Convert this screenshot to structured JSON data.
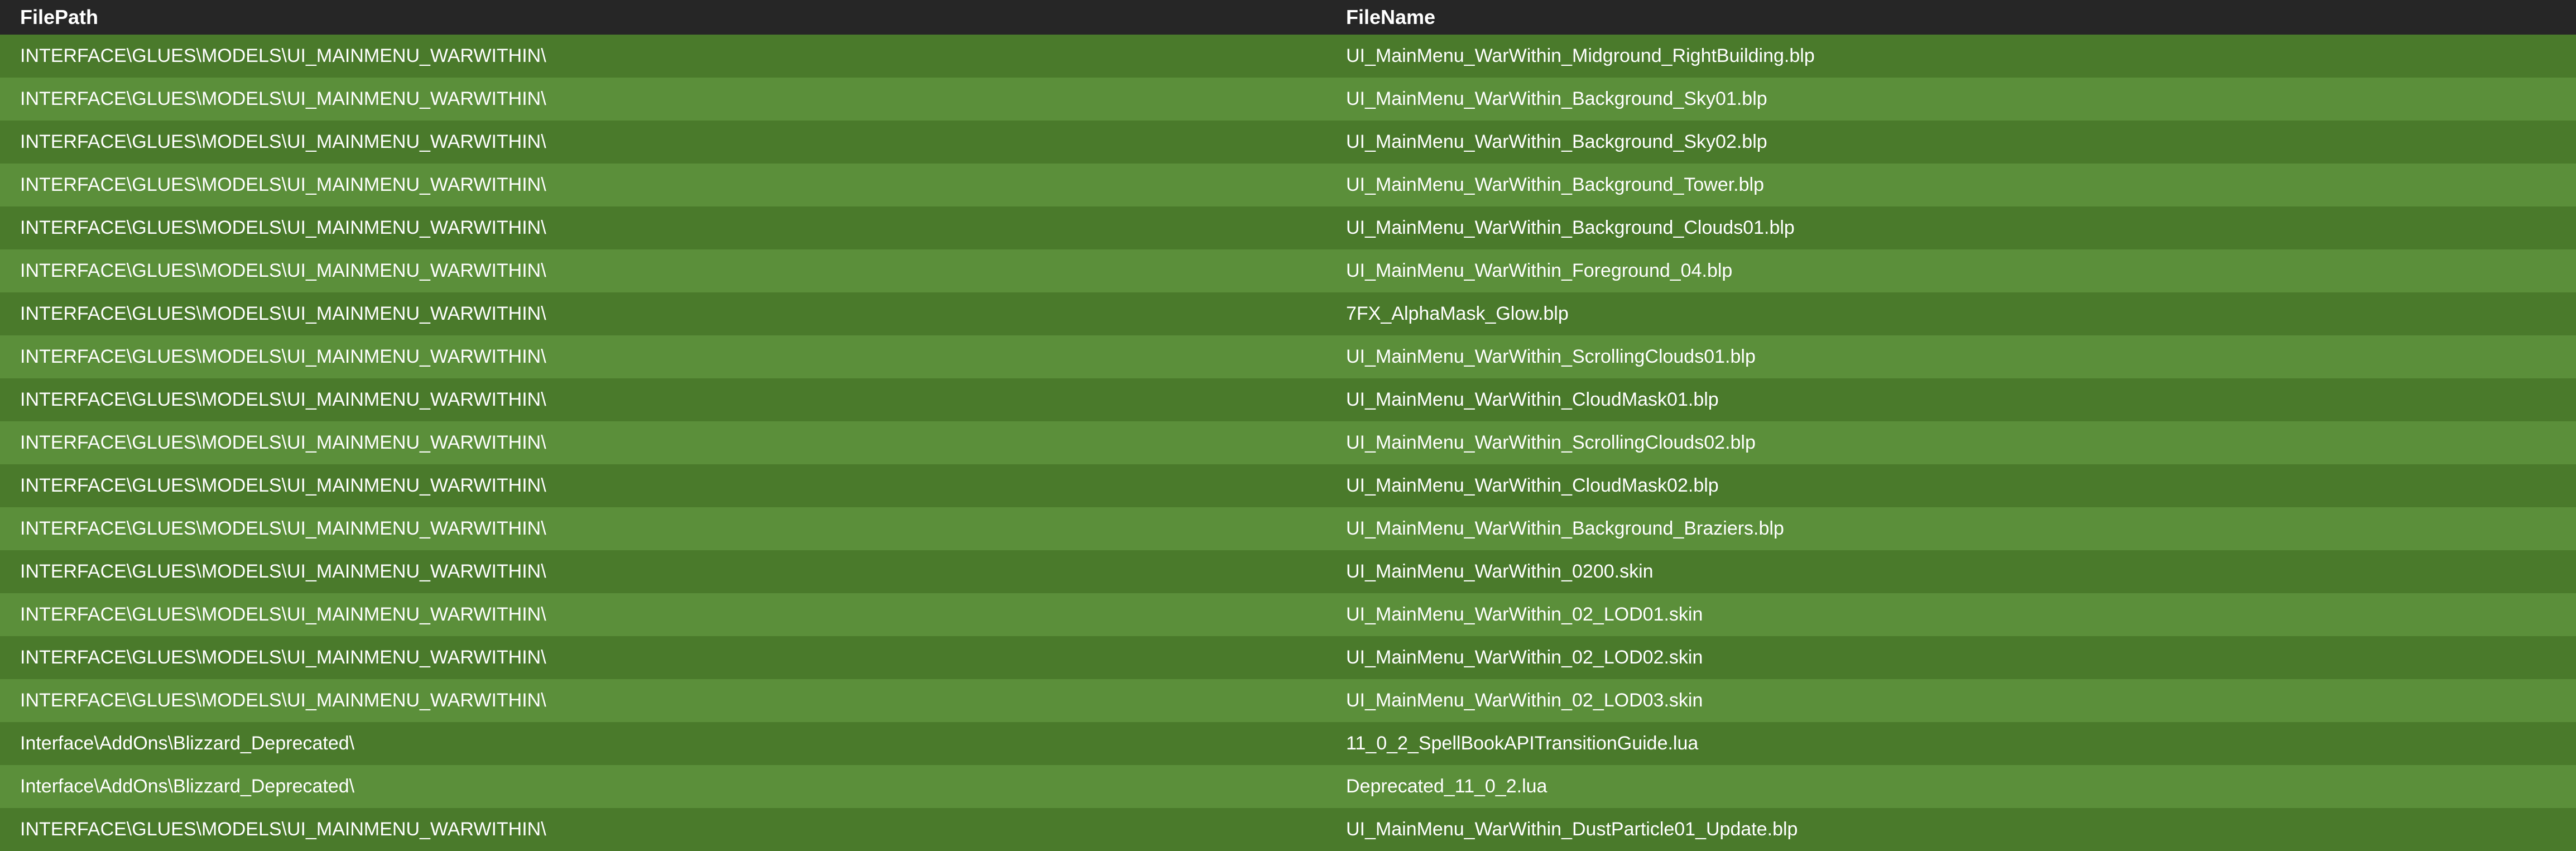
{
  "columns": {
    "filepath": "FilePath",
    "filename": "FileName"
  },
  "rows": [
    {
      "path": "INTERFACE\\GLUES\\MODELS\\UI_MAINMENU_WARWITHIN\\",
      "name": "UI_MainMenu_WarWithin_Midground_RightBuilding.blp"
    },
    {
      "path": "INTERFACE\\GLUES\\MODELS\\UI_MAINMENU_WARWITHIN\\",
      "name": "UI_MainMenu_WarWithin_Background_Sky01.blp"
    },
    {
      "path": "INTERFACE\\GLUES\\MODELS\\UI_MAINMENU_WARWITHIN\\",
      "name": "UI_MainMenu_WarWithin_Background_Sky02.blp"
    },
    {
      "path": "INTERFACE\\GLUES\\MODELS\\UI_MAINMENU_WARWITHIN\\",
      "name": "UI_MainMenu_WarWithin_Background_Tower.blp"
    },
    {
      "path": "INTERFACE\\GLUES\\MODELS\\UI_MAINMENU_WARWITHIN\\",
      "name": "UI_MainMenu_WarWithin_Background_Clouds01.blp"
    },
    {
      "path": "INTERFACE\\GLUES\\MODELS\\UI_MAINMENU_WARWITHIN\\",
      "name": "UI_MainMenu_WarWithin_Foreground_04.blp"
    },
    {
      "path": "INTERFACE\\GLUES\\MODELS\\UI_MAINMENU_WARWITHIN\\",
      "name": "7FX_AlphaMask_Glow.blp"
    },
    {
      "path": "INTERFACE\\GLUES\\MODELS\\UI_MAINMENU_WARWITHIN\\",
      "name": "UI_MainMenu_WarWithin_ScrollingClouds01.blp"
    },
    {
      "path": "INTERFACE\\GLUES\\MODELS\\UI_MAINMENU_WARWITHIN\\",
      "name": "UI_MainMenu_WarWithin_CloudMask01.blp"
    },
    {
      "path": "INTERFACE\\GLUES\\MODELS\\UI_MAINMENU_WARWITHIN\\",
      "name": "UI_MainMenu_WarWithin_ScrollingClouds02.blp"
    },
    {
      "path": "INTERFACE\\GLUES\\MODELS\\UI_MAINMENU_WARWITHIN\\",
      "name": "UI_MainMenu_WarWithin_CloudMask02.blp"
    },
    {
      "path": "INTERFACE\\GLUES\\MODELS\\UI_MAINMENU_WARWITHIN\\",
      "name": "UI_MainMenu_WarWithin_Background_Braziers.blp"
    },
    {
      "path": "INTERFACE\\GLUES\\MODELS\\UI_MAINMENU_WARWITHIN\\",
      "name": "UI_MainMenu_WarWithin_0200.skin"
    },
    {
      "path": "INTERFACE\\GLUES\\MODELS\\UI_MAINMENU_WARWITHIN\\",
      "name": "UI_MainMenu_WarWithin_02_LOD01.skin"
    },
    {
      "path": "INTERFACE\\GLUES\\MODELS\\UI_MAINMENU_WARWITHIN\\",
      "name": "UI_MainMenu_WarWithin_02_LOD02.skin"
    },
    {
      "path": "INTERFACE\\GLUES\\MODELS\\UI_MAINMENU_WARWITHIN\\",
      "name": "UI_MainMenu_WarWithin_02_LOD03.skin"
    },
    {
      "path": "Interface\\AddOns\\Blizzard_Deprecated\\",
      "name": "11_0_2_SpellBookAPITransitionGuide.lua"
    },
    {
      "path": "Interface\\AddOns\\Blizzard_Deprecated\\",
      "name": "Deprecated_11_0_2.lua"
    },
    {
      "path": "INTERFACE\\GLUES\\MODELS\\UI_MAINMENU_WARWITHIN\\",
      "name": "UI_MainMenu_WarWithin_DustParticle01_Update.blp"
    }
  ]
}
